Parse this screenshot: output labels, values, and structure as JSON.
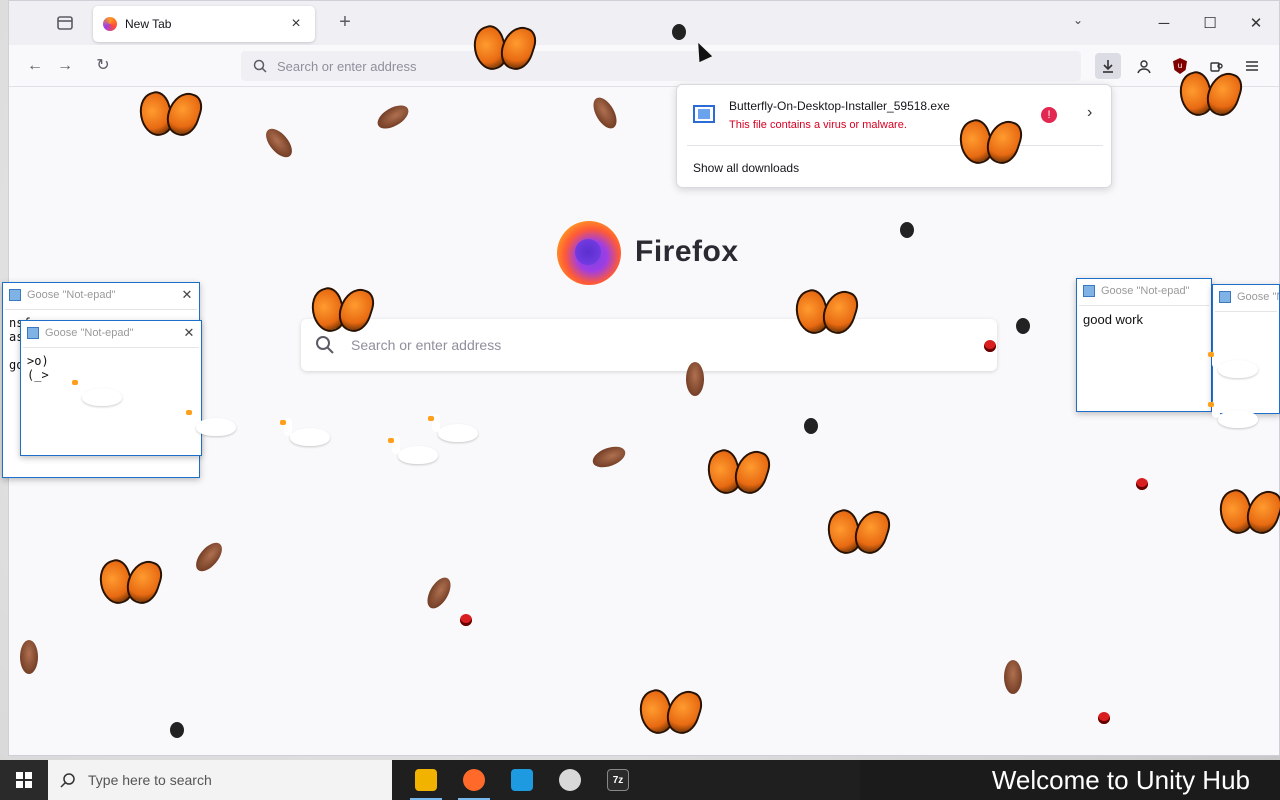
{
  "browser": {
    "tab": {
      "title": "New Tab"
    },
    "new_tab_symbol": "+",
    "urlbar": {
      "placeholder": "Search or enter address"
    },
    "window_controls": [
      "─",
      "☐",
      "✕"
    ],
    "list_all_tabs_symbol": "⌄"
  },
  "downloads": {
    "item": {
      "filename": "Butterfly-On-Desktop-Installer_59518.exe",
      "status": "This file contains a virus or malware."
    },
    "show_all_label": "Show all downloads"
  },
  "newtab": {
    "wordmark": "Firefox",
    "search_placeholder": "Search or enter address"
  },
  "notepads": {
    "left_back": {
      "title": "Goose \"Not-epad\"",
      "text": "nsf\nasc\n\ngo"
    },
    "left_front": {
      "title": "Goose \"Not-epad\"",
      "text": ">o)\n(_>"
    },
    "right": {
      "title": "Goose \"Not-epad\"",
      "text": "good work"
    },
    "right_edge": {
      "title": "Goose \"Not-epad\""
    }
  },
  "taskbar": {
    "search_placeholder": "Type here to search",
    "apps": [
      {
        "name": "file-explorer",
        "color": "#f2b300"
      },
      {
        "name": "firefox",
        "color": "#ff6a2a"
      },
      {
        "name": "unity-hub",
        "color": "#1e9be0"
      },
      {
        "name": "unity",
        "color": "#d8d8d8"
      },
      {
        "name": "7-zip",
        "color": "#2b2b2b",
        "label": "7z"
      }
    ],
    "banner_text": "Welcome to Unity Hub"
  }
}
